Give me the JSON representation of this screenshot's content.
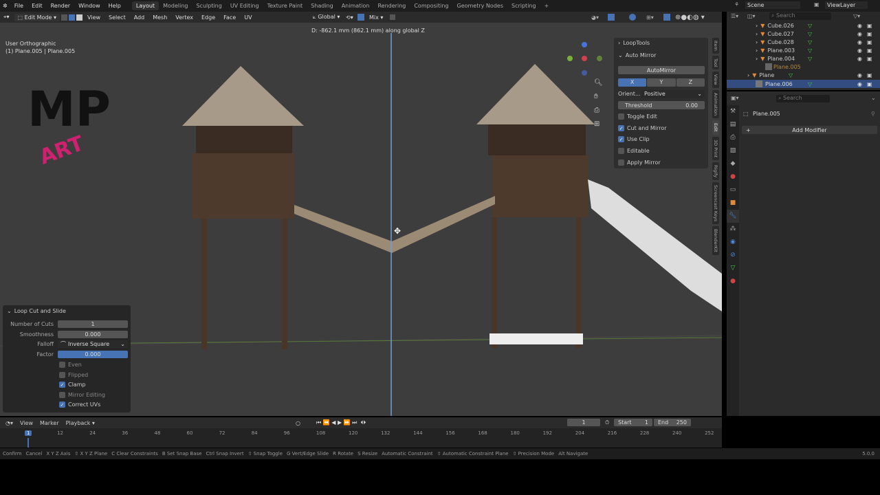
{
  "topbar": {
    "menus": [
      "File",
      "Edit",
      "Render",
      "Window",
      "Help"
    ],
    "workspaces": [
      "Layout",
      "Modeling",
      "Sculpting",
      "UV Editing",
      "Texture Paint",
      "Shading",
      "Animation",
      "Rendering",
      "Compositing",
      "Geometry Nodes",
      "Scripting"
    ],
    "active_workspace": "Layout",
    "add": "+",
    "scene": "Scene",
    "view_layer": "ViewLayer"
  },
  "viewport_header": {
    "mode": "Edit Mode",
    "menus": [
      "View",
      "Select",
      "Add",
      "Mesh",
      "Vertex",
      "Edge",
      "Face",
      "UV"
    ],
    "orientation": "Global",
    "pivot": "Mix"
  },
  "viewport": {
    "view_name": "User Orthographic",
    "object_info": "(1) Plane.005 | Plane.005",
    "transform_info": "D: -862.1 mm (862.1 mm) along global Z",
    "logo_text": "MP ART"
  },
  "npanel": {
    "loop_tools": "LoopTools",
    "auto_mirror": "Auto Mirror",
    "automirror_button": "AutoMirror",
    "axes": [
      "X",
      "Y",
      "Z"
    ],
    "active_axis": "X",
    "orientation_label": "Orient...",
    "orientation_value": "Positive",
    "threshold_label": "Threshold",
    "threshold_value": "0.00",
    "options": [
      {
        "label": "Toggle Edit",
        "checked": false
      },
      {
        "label": "Cut and Mirror",
        "checked": true
      },
      {
        "label": "Use Clip",
        "checked": true
      },
      {
        "label": "Editable",
        "checked": false
      },
      {
        "label": "Apply Mirror",
        "checked": false
      }
    ]
  },
  "sidebar_tabs": [
    "Item",
    "Tool",
    "View",
    "Animation",
    "Edit",
    "3D Print",
    "Rigify",
    "Screencast Keys",
    "BlenderKit"
  ],
  "outliner": {
    "search_placeholder": "Search",
    "items": [
      {
        "name": "Cube.026"
      },
      {
        "name": "Cube.027"
      },
      {
        "name": "Cube.028"
      },
      {
        "name": "Plane.003"
      },
      {
        "name": "Plane.004"
      },
      {
        "name": "Plane.005"
      },
      {
        "name": "Plane"
      },
      {
        "name": "Plane.006"
      }
    ]
  },
  "properties": {
    "search_placeholder": "Search",
    "object_name": "Plane.005",
    "add_modifier": "Add Modifier"
  },
  "last_operator": {
    "title": "Loop Cut and Slide",
    "fields": [
      {
        "label": "Number of Cuts",
        "value": "1"
      },
      {
        "label": "Smoothness",
        "value": "0.000"
      },
      {
        "label": "Falloff",
        "value": "Inverse Square"
      },
      {
        "label": "Factor",
        "value": "0.000"
      }
    ],
    "options": [
      {
        "label": "Even",
        "checked": false
      },
      {
        "label": "Flipped",
        "checked": false
      },
      {
        "label": "Clamp",
        "checked": true
      },
      {
        "label": "Mirror Editing",
        "checked": false
      },
      {
        "label": "Correct UVs",
        "checked": true
      }
    ]
  },
  "timeline": {
    "menus": [
      "View",
      "Marker",
      "Playback"
    ],
    "current_frame": "1",
    "start_label": "Start",
    "start": "1",
    "end_label": "End",
    "end": "250",
    "ticks": [
      "1",
      "12",
      "24",
      "36",
      "48",
      "60",
      "72",
      "84",
      "96",
      "108",
      "120",
      "132",
      "144",
      "156",
      "168",
      "180",
      "192",
      "204",
      "216",
      "228",
      "240",
      "252"
    ]
  },
  "statusbar": {
    "items": [
      "Confirm",
      "Cancel",
      "X Y Z Axis",
      "⇧ X Y Z Plane",
      "C Clear Constraints",
      "B Set Snap Base",
      "Ctrl Snap Invert",
      "⇧ Snap Toggle",
      "G Vert/Edge Slide",
      "R Rotate",
      "S Resize",
      "Automatic Constraint",
      "⇧ Automatic Constraint Plane",
      "⇧ Precision Mode",
      "Alt Navigate"
    ],
    "version": "5.0.0"
  },
  "colors": {
    "accent": "#4772b3",
    "bg": "#3d3d3d"
  }
}
